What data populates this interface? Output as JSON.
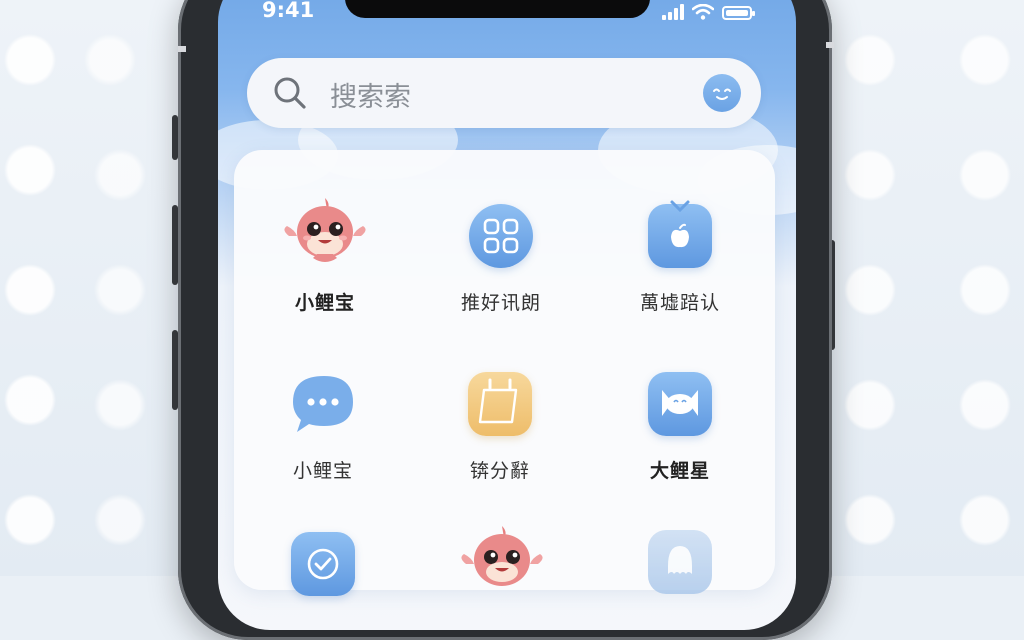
{
  "status_bar": {
    "time": "9:41",
    "icons": [
      "signal-icon",
      "wifi-icon",
      "battery-icon"
    ]
  },
  "search": {
    "placeholder": "搜索索",
    "icon": "search-icon",
    "avatar_icon": "smile-face-icon"
  },
  "apps": [
    {
      "label": "小鲤宝",
      "icon": "koi-mascot-icon",
      "bold": true
    },
    {
      "label": "推好讯朗",
      "icon": "grid-apps-icon"
    },
    {
      "label": "萬墟踣认",
      "icon": "tv-apple-icon"
    },
    {
      "label": "小鲤宝",
      "icon": "chat-bubble-icon"
    },
    {
      "label": "锛分辭",
      "icon": "calendar-folder-icon"
    },
    {
      "label": "大鲤星",
      "icon": "fish-icon"
    },
    {
      "label": "",
      "icon": "checkmark-icon"
    },
    {
      "label": "",
      "icon": "koi-mascot-icon"
    },
    {
      "label": "",
      "icon": "octopus-icon"
    }
  ],
  "colors": {
    "accent_blue": "#6aa2e4",
    "accent_yellow": "#eebd6a",
    "mascot_pink": "#e88a8a"
  }
}
